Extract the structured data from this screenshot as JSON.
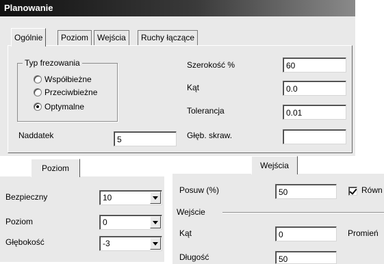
{
  "dialog": {
    "title": "Planowanie",
    "tabs": [
      {
        "label": "Ogólnie"
      },
      {
        "label": "Poziom"
      },
      {
        "label": "Wejścia"
      },
      {
        "label": "Ruchy łączące"
      }
    ],
    "milling_type": {
      "legend": "Typ frezowania",
      "options": [
        {
          "label": "Współbieżne",
          "selected": false
        },
        {
          "label": "Przeciwbieżne",
          "selected": false
        },
        {
          "label": "Optymalne",
          "selected": true
        }
      ]
    },
    "fields": {
      "naddatek": {
        "label": "Naddatek",
        "value": "5"
      },
      "szerokosc": {
        "label": "Szerokość %",
        "value": "60"
      },
      "kat": {
        "label": "Kąt",
        "value": "0.0"
      },
      "tolerancja": {
        "label": "Tolerancja",
        "value": "0.01"
      },
      "glebokosc_skrawania": {
        "label": "Głęb. skraw.",
        "value": ""
      }
    }
  },
  "poziom_panel": {
    "tab_label": "Poziom",
    "rows": [
      {
        "label": "Bezpieczny",
        "value": "10"
      },
      {
        "label": "Poziom",
        "value": "0"
      },
      {
        "label": "Głębokość",
        "value": "-3"
      }
    ]
  },
  "wejscia_panel": {
    "tab_label": "Wejścia",
    "posuw": {
      "label": "Posuw (%)",
      "value": "50"
    },
    "checkbox": {
      "label": "Równ",
      "checked": true
    },
    "section_label": "Wejście",
    "kat": {
      "label": "Kąt",
      "value": "0"
    },
    "promien_label": "Promień",
    "dlugosc": {
      "label": "Długość",
      "value": "50"
    }
  }
}
